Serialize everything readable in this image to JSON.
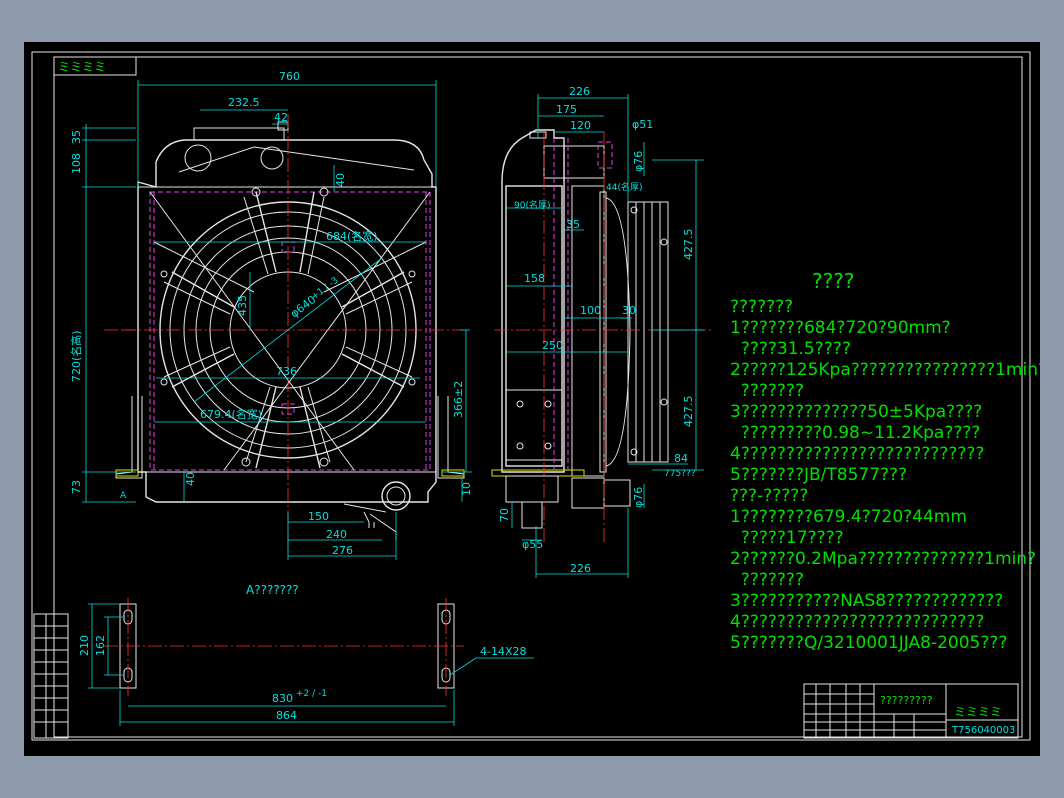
{
  "corner_label": "ミミミミ",
  "front_view": {
    "dims": {
      "width": "760",
      "d232": "232.5",
      "d42": "42",
      "d35": "35",
      "d108": "108",
      "d40_top": "40",
      "core_h": "720(名高)",
      "d73": "73",
      "d40_bot": "40",
      "d10": "10",
      "fan_w": "684(名宽)",
      "fan_dia": "φ640",
      "fan_tol": "+1 / -3",
      "d435": "435",
      "d736": "736",
      "core_w": "679.4(名宽)",
      "d366": "366±2",
      "d150": "150",
      "d240": "240",
      "d276": "276",
      "arrow_a": "A"
    }
  },
  "side_view": {
    "dims": {
      "d226_top": "226",
      "d175": "175",
      "d120": "120",
      "phi51": "φ51",
      "phi76_top": "φ76",
      "d44": "44(名厚)",
      "d90": "90(名厚)",
      "d35": "35",
      "d158": "158",
      "d100": "100",
      "d30": "30",
      "d250": "250",
      "d427_top": "427.5",
      "d427_bot": "427.5",
      "d84": "84",
      "d775": "775???",
      "phi76_bot": "φ76",
      "d70": "70",
      "phi55": "φ55",
      "d226_bot": "226"
    }
  },
  "view_a": {
    "title": "A???????",
    "d210": "210",
    "d162": "162",
    "holes": "4-14X28",
    "d830": "830",
    "d830_tol": "+2 / -1",
    "d864": "864"
  },
  "notes": {
    "heading": "????",
    "lines": [
      "???????",
      "1???????684?720?90mm?",
      "  ????31.5????",
      "2?????125Kpa????????????????1min?",
      "  ???????",
      "3??????????????50±5Kpa????",
      "  ?????????0.98~11.2Kpa????",
      "4???????????????????????????",
      "5???????JB/T8577???",
      "???-?????",
      "1????????679.4?720?44mm",
      "  ?????17????",
      "2??????0.2Mpa??????????????1min?",
      "  ???????",
      "3???????????NAS8?????????????",
      "4???????????????????????????",
      "5???????Q/3210001JJA8-2005???"
    ]
  },
  "title_block": {
    "name": "?????????",
    "marks": "ミミミミ",
    "drawing_no": "T756040003"
  },
  "colors": {
    "background": "#8c9aab",
    "canvas": "#000000",
    "outline": "#e6e6e6",
    "dimension": "#00e0e0",
    "centerline": "#ff3030",
    "hidden": "#e040e0",
    "notes": "#00e000"
  }
}
